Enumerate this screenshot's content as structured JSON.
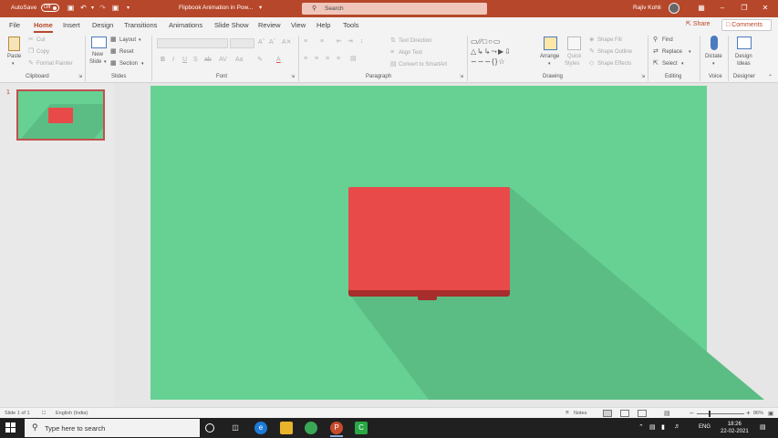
{
  "titlebar": {
    "autosave_label": "AutoSave",
    "autosave_state": "Off",
    "doc_title": "Flipbook Animation in Pow...",
    "search_placeholder": "Search",
    "user_name": "Rajiv Kohli",
    "accent_color": "#b7472a"
  },
  "tabs": {
    "items": [
      "File",
      "Home",
      "Insert",
      "Design",
      "Transitions",
      "Animations",
      "Slide Show",
      "Review",
      "View",
      "Help",
      "Tools"
    ],
    "active": "Home",
    "share_label": "Share",
    "comments_label": "Comments"
  },
  "ribbon": {
    "clipboard": {
      "paste": "Paste",
      "cut": "Cut",
      "copy": "Copy",
      "format_painter": "Format Painter",
      "group": "Clipboard"
    },
    "slides": {
      "new_slide_line1": "New",
      "new_slide_line2": "Slide",
      "layout": "Layout",
      "reset": "Reset",
      "section": "Section",
      "group": "Slides"
    },
    "font": {
      "group": "Font",
      "buttons": [
        "B",
        "I",
        "U",
        "S",
        "ab",
        "AV",
        "Aa"
      ]
    },
    "paragraph": {
      "text_direction": "Text Direction",
      "align_text": "Align Text",
      "convert_smartart": "Convert to SmartArt",
      "group": "Paragraph"
    },
    "drawing": {
      "arrange": "Arrange",
      "quick_styles_line1": "Quick",
      "quick_styles_line2": "Styles",
      "shape_fill": "Shape Fill",
      "shape_outline": "Shape Outline",
      "shape_effects": "Shape Effects",
      "group": "Drawing"
    },
    "editing": {
      "find": "Find",
      "replace": "Replace",
      "select": "Select",
      "group": "Editing"
    },
    "voice": {
      "dictate": "Dictate",
      "group": "Voice"
    },
    "designer": {
      "design_ideas_line1": "Design",
      "design_ideas_line2": "Ideas",
      "group": "Designer"
    }
  },
  "thumbnails": {
    "slide_number": "1"
  },
  "slide": {
    "background_color": "#66d193",
    "shadow_color": "#5bbd84",
    "book_color": "#e84a4a",
    "book_edge_color": "#a82d2d"
  },
  "status": {
    "slide_info": "Slide 1 of 1",
    "language": "English (India)",
    "notes": "Notes",
    "zoom": "86%"
  },
  "taskbar": {
    "search_placeholder": "Type here to search",
    "language": "ENG",
    "time": "18:26",
    "date": "22-02-2021"
  }
}
